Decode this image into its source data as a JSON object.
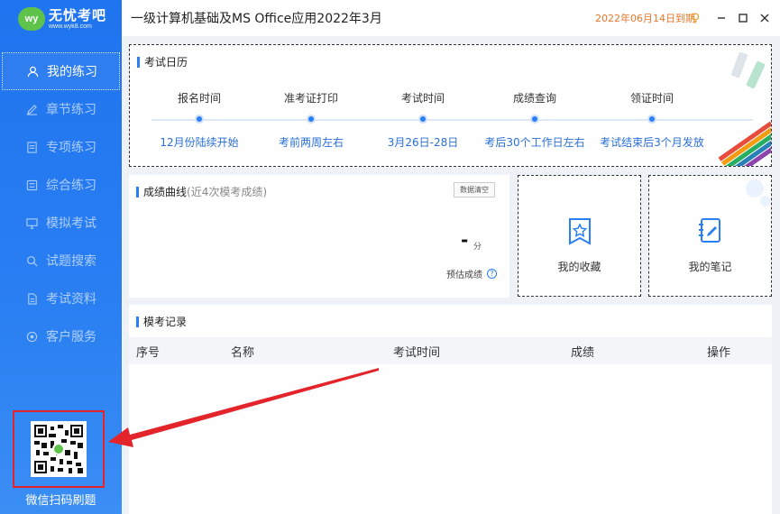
{
  "logo": {
    "badge": "wy",
    "name": "无忧考吧",
    "url": "www.wyk8.com"
  },
  "sidebar": {
    "items": [
      {
        "label": "我的练习",
        "icon": "user-icon",
        "active": true
      },
      {
        "label": "章节练习",
        "icon": "pencil-icon"
      },
      {
        "label": "专项练习",
        "icon": "document-icon"
      },
      {
        "label": "综合练习",
        "icon": "layers-icon"
      },
      {
        "label": "模拟考试",
        "icon": "monitor-icon"
      },
      {
        "label": "试题搜索",
        "icon": "search-icon"
      },
      {
        "label": "考试资料",
        "icon": "file-icon"
      },
      {
        "label": "客户服务",
        "icon": "headset-icon"
      }
    ],
    "qr_caption": "微信扫码刷题"
  },
  "header": {
    "title": "一级计算机基础及MS Office应用2022年3月",
    "expire": "2022年06月14日到期"
  },
  "calendar": {
    "title": "考试日历",
    "steps": [
      {
        "label": "报名时间",
        "value": "12月份陆续开始"
      },
      {
        "label": "准考证打印",
        "value": "考前两周左右"
      },
      {
        "label": "考试时间",
        "value": "3月26日-28日"
      },
      {
        "label": "成绩查询",
        "value": "考后30个工作日左右"
      },
      {
        "label": "领证时间",
        "value": "考试结束后3个月发放"
      }
    ]
  },
  "score": {
    "title": "成绩曲线",
    "subtitle": "(近4次模考成绩)",
    "clear_label": "数据清空",
    "value": "-",
    "unit": "分",
    "estimate_label": "预估成绩",
    "help": "?"
  },
  "favorites": {
    "label": "我的收藏"
  },
  "notes": {
    "label": "我的笔记"
  },
  "records": {
    "title": "模考记录",
    "columns": [
      "序号",
      "名称",
      "考试时间",
      "成绩",
      "操作"
    ]
  },
  "colors": {
    "primary": "#2a7ff2",
    "accent": "#e8762c",
    "annotation": "#e3242b"
  }
}
